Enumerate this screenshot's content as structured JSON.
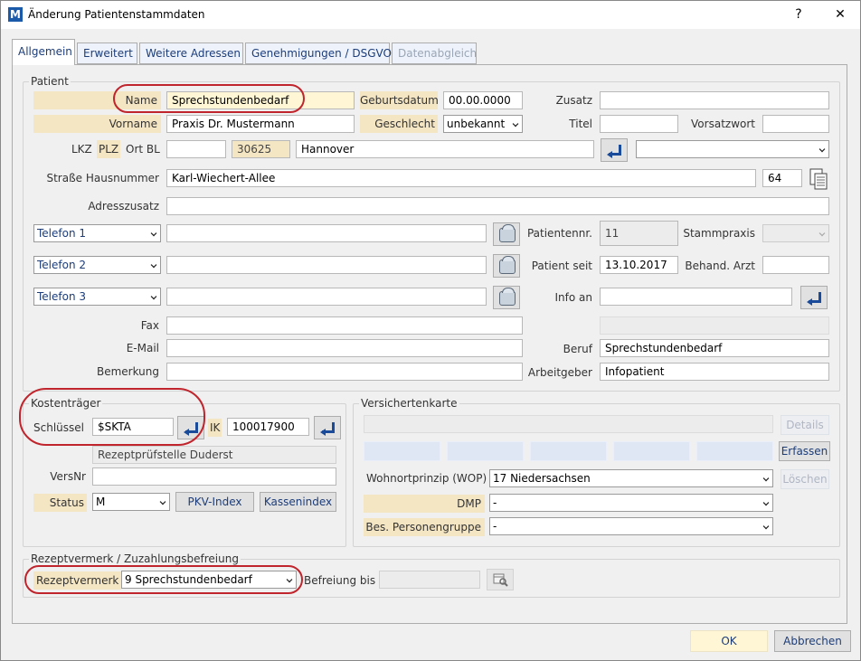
{
  "window": {
    "title": "Änderung Patientenstammdaten",
    "help": "?",
    "close": "✕",
    "logo": "M"
  },
  "tabs": [
    {
      "label": "Allgemein"
    },
    {
      "label": "Erweitert"
    },
    {
      "label": "Weitere Adressen"
    },
    {
      "label": "Genehmigungen / DSGVO"
    },
    {
      "label": "Datenabgleich"
    }
  ],
  "patient": {
    "legend": "Patient",
    "name_label": "Name",
    "name_value": "Sprechstundenbedarf",
    "geburtsdatum_label": "Geburtsdatum",
    "geburtsdatum_value": "00.00.0000",
    "zusatz_label": "Zusatz",
    "zusatz_value": "",
    "vorname_label": "Vorname",
    "vorname_value": "Praxis Dr. Mustermann",
    "geschlecht_label": "Geschlecht",
    "geschlecht_value": "unbekannt",
    "titel_label": "Titel",
    "vorsatzwort_label": "Vorsatzwort",
    "lkz_label": "LKZ",
    "plz_label": "PLZ",
    "ort_label": "Ort BL",
    "plz_value": "30625",
    "ort_value": "Hannover",
    "strasse_label": "Straße Hausnummer",
    "strasse_value": "Karl-Wiechert-Allee",
    "hausnummer_value": "64",
    "adresszusatz_label": "Adresszusatz",
    "telefon1_label": "Telefon 1",
    "telefon2_label": "Telefon 2",
    "telefon3_label": "Telefon 3",
    "patientennr_label": "Patientennr.",
    "patientennr_value": "11",
    "stammpraxis_label": "Stammpraxis",
    "patient_seit_label": "Patient seit",
    "patient_seit_value": "13.10.2017",
    "behand_arzt_label": "Behand. Arzt",
    "info_an_label": "Info an",
    "fax_label": "Fax",
    "email_label": "E-Mail",
    "beruf_label": "Beruf",
    "beruf_value": "Sprechstundenbedarf",
    "bemerkung_label": "Bemerkung",
    "arbeitgeber_label": "Arbeitgeber",
    "arbeitgeber_value": "Infopatient"
  },
  "kostentraeger": {
    "legend": "Kostenträger",
    "schluessel_label": "Schlüssel",
    "schluessel_value": "$SKTA",
    "ik_label": "IK",
    "ik_value": "100017900",
    "name_value": "Rezeptprüfstelle Duderst",
    "versnr_label": "VersNr",
    "status_label": "Status",
    "status_value": "M",
    "pkv_index": "PKV-Index",
    "kassenindex": "Kassenindex"
  },
  "versichertenkarte": {
    "legend": "Versichertenkarte",
    "details": "Details",
    "erfassen": "Erfassen",
    "loeschen": "Löschen",
    "wop_label": "Wohnortprinzip (WOP)",
    "wop_value": "17 Niedersachsen",
    "dmp_label": "DMP",
    "dmp_value": "-",
    "bes_label": "Bes. Personengruppe",
    "bes_value": "-"
  },
  "rezept": {
    "legend": "Rezeptvermerk / Zuzahlungsbefreiung",
    "vermerk_label": "Rezeptvermerk",
    "vermerk_value": "9 Sprechstundenbedarf",
    "befreiung_label": "Befreiung bis"
  },
  "footer": {
    "ok": "OK",
    "abbrechen": "Abbrechen"
  },
  "colors": {
    "highlight": "#f5e6c3",
    "annotation": "#c0242c",
    "link_text": "#1c3d7a"
  }
}
